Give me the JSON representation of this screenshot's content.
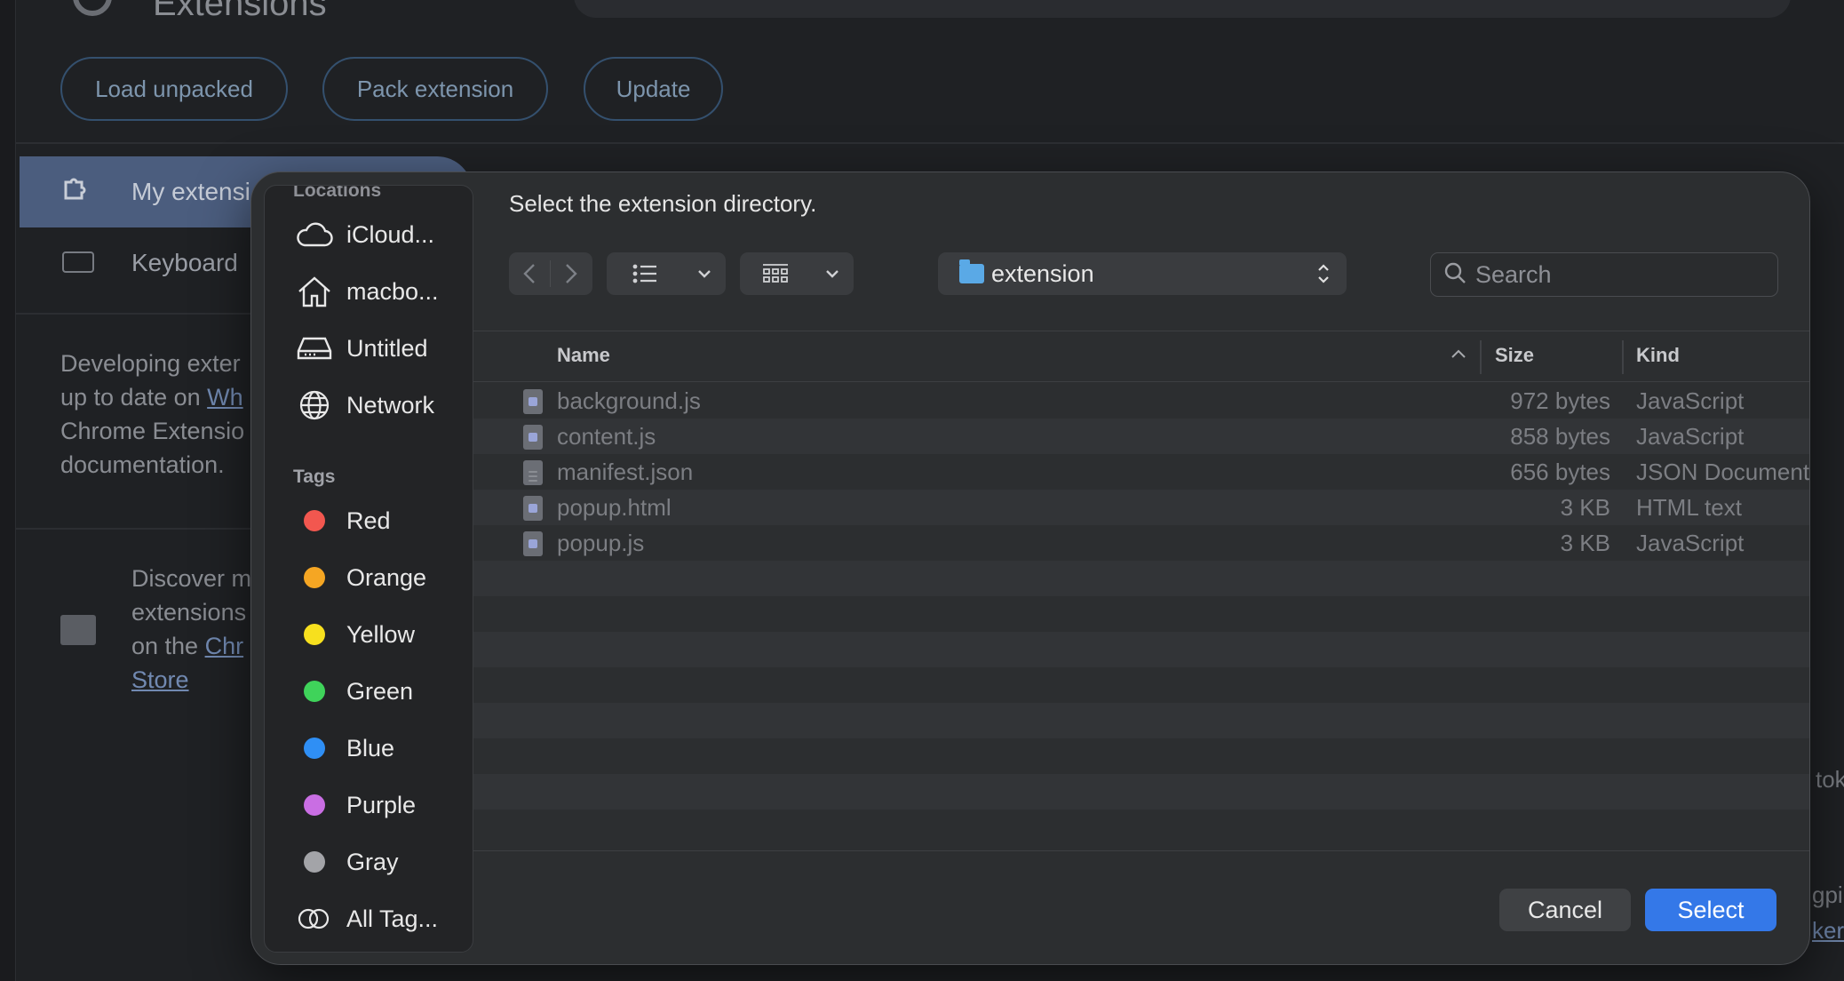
{
  "background": {
    "title": "Extensions",
    "buttons": {
      "load_unpacked": "Load unpacked",
      "pack_extension": "Pack extension",
      "update": "Update"
    },
    "nav": {
      "my_extensions": "My extensi",
      "keyboard": "Keyboard"
    },
    "developing_text": [
      "Developing exter",
      "up to date on ",
      "Chrome Extensio",
      "documentation."
    ],
    "developing_link": "Wh",
    "discover_text": [
      "Discover m",
      "extensions",
      "on the "
    ],
    "discover_link_1": "Chr",
    "discover_link_2": "Store",
    "right_fragments": [
      "tok",
      "gpil",
      "ker"
    ]
  },
  "dialog": {
    "prompt": "Select the extension directory.",
    "sidebar": {
      "section_label": "Locations",
      "locations": [
        {
          "label": "iCloud...",
          "icon": "cloud-icon"
        },
        {
          "label": "macbo...",
          "icon": "home-icon"
        },
        {
          "label": "Untitled",
          "icon": "drive-icon"
        },
        {
          "label": "Network",
          "icon": "globe-icon"
        }
      ],
      "tags_label": "Tags",
      "tags": [
        {
          "label": "Red",
          "color": "#f2574f"
        },
        {
          "label": "Orange",
          "color": "#f5a623"
        },
        {
          "label": "Yellow",
          "color": "#f7e01e"
        },
        {
          "label": "Green",
          "color": "#3fd35a"
        },
        {
          "label": "Blue",
          "color": "#2f8ff5"
        },
        {
          "label": "Purple",
          "color": "#c96ee3"
        },
        {
          "label": "Gray",
          "color": "#a3a4a8"
        }
      ],
      "all_tags": "All Tag..."
    },
    "path": "extension",
    "search_placeholder": "Search",
    "columns": {
      "name": "Name",
      "size": "Size",
      "kind": "Kind"
    },
    "files": [
      {
        "name": "background.js",
        "size": "972 bytes",
        "kind": "JavaScript",
        "icon": "js-file-icon"
      },
      {
        "name": "content.js",
        "size": "858 bytes",
        "kind": "JavaScript",
        "icon": "js-file-icon"
      },
      {
        "name": "manifest.json",
        "size": "656 bytes",
        "kind": "JSON Document",
        "icon": "json-file-icon"
      },
      {
        "name": "popup.html",
        "size": "3 KB",
        "kind": "HTML text",
        "icon": "html-file-icon"
      },
      {
        "name": "popup.js",
        "size": "3 KB",
        "kind": "JavaScript",
        "icon": "js-file-icon"
      }
    ],
    "buttons": {
      "cancel": "Cancel",
      "select": "Select"
    }
  }
}
